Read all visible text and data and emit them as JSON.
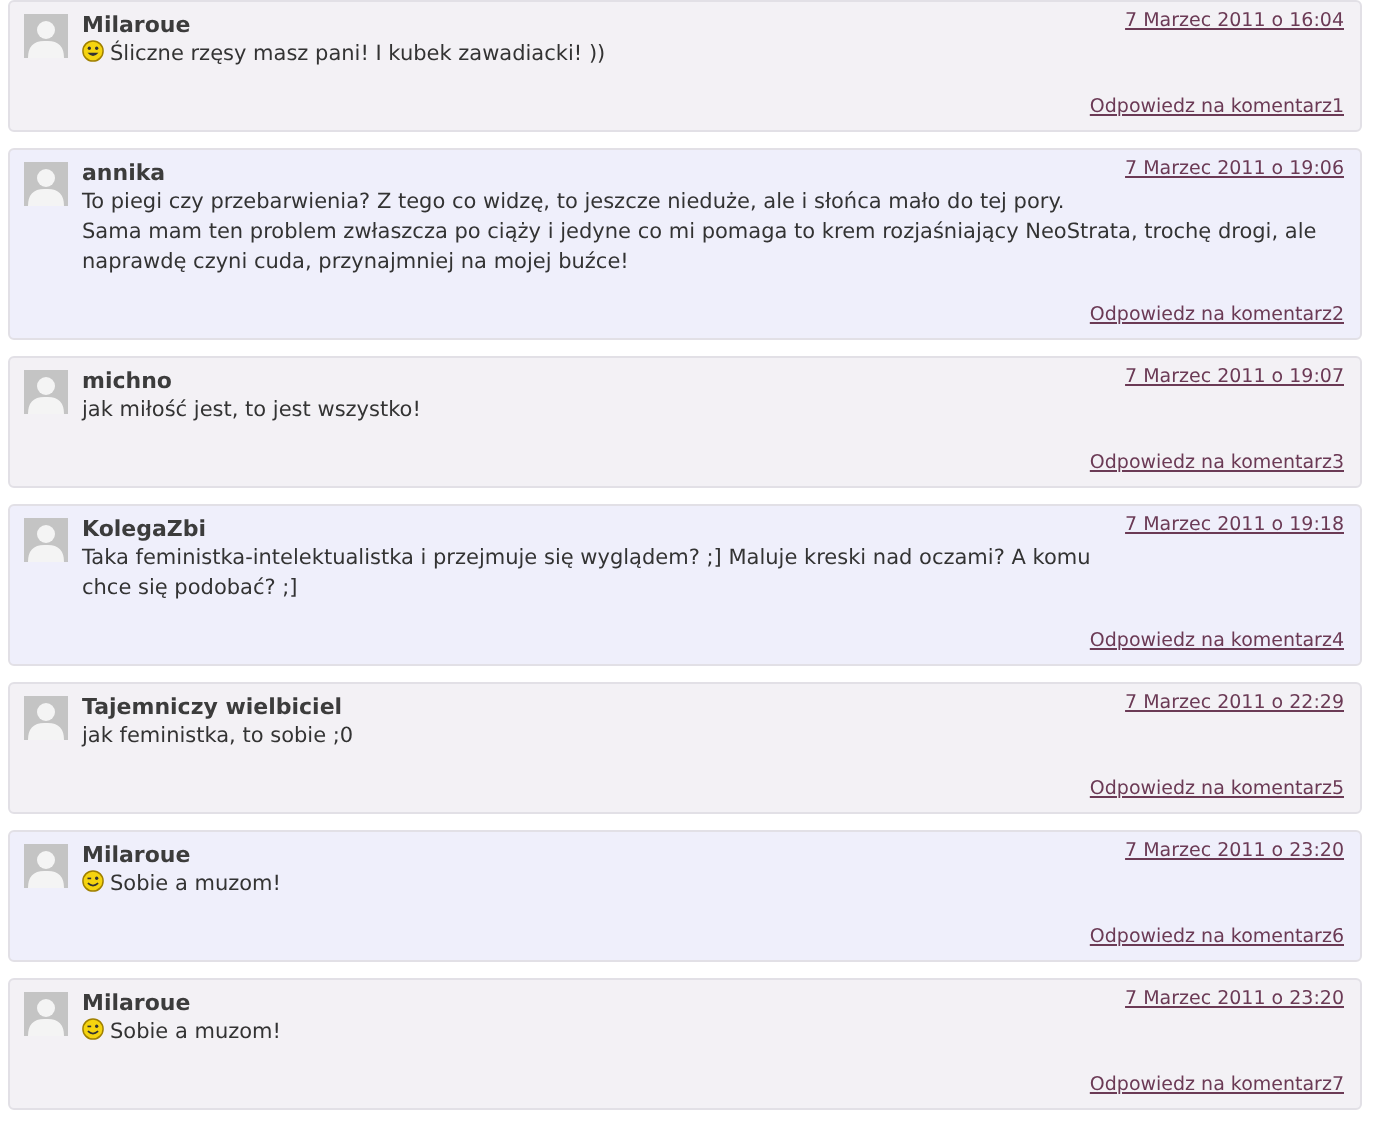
{
  "comments": [
    {
      "author": "Milaroue",
      "date": "7 Marzec 2011 o 16:04",
      "kind": "smiley",
      "text": "Śliczne rzęsy masz pani! I kubek zawadiacki! ))",
      "reply": "Odpowiedz na komentarz1"
    },
    {
      "author": "annika",
      "date": "7 Marzec 2011 o 19:06",
      "kind": "plain",
      "text": "To piegi czy przebarwienia? Z tego co widzę, to jeszcze nieduże, ale i słońca mało do tej pory.\nSama mam ten problem zwłaszcza po ciąży i jedyne co mi pomaga to krem rozjaśniający NeoStrata, trochę drogi, ale naprawdę czyni cuda, przynajmniej na mojej buźce!",
      "reply": "Odpowiedz na komentarz2"
    },
    {
      "author": "michno",
      "date": "7 Marzec 2011 o 19:07",
      "kind": "plain",
      "text": "jak miłość jest, to jest wszystko!",
      "reply": "Odpowiedz na komentarz3"
    },
    {
      "author": "KolegaZbi",
      "date": "7 Marzec 2011 o 19:18",
      "kind": "plain",
      "text": "Taka feministka-intelektualistka i przejmuje się wyglądem? ;] Maluje kreski nad oczami? A komu\nchce się podobać? ;]",
      "reply": "Odpowiedz na komentarz4"
    },
    {
      "author": "Tajemniczy wielbiciel",
      "date": "7 Marzec 2011 o 22:29",
      "kind": "plain",
      "text": "jak feministka, to sobie ;0",
      "reply": "Odpowiedz na komentarz5"
    },
    {
      "author": "Milaroue",
      "date": "7 Marzec 2011 o 23:20",
      "kind": "wink",
      "text": "Sobie a muzom!",
      "reply": "Odpowiedz na komentarz6"
    },
    {
      "author": "Milaroue",
      "date": "7 Marzec 2011 o 23:20",
      "kind": "wink",
      "text": "Sobie a muzom!",
      "reply": "Odpowiedz na komentarz7"
    }
  ]
}
